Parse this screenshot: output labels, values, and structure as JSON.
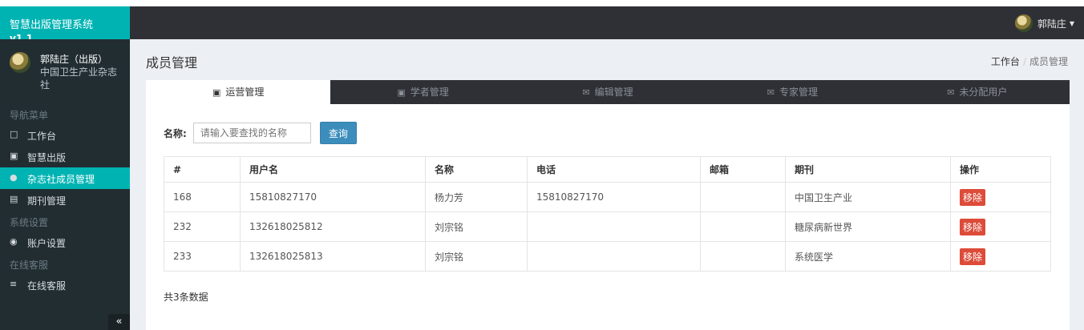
{
  "brand": {
    "title": "智慧出版管理系统",
    "version": "v1.1"
  },
  "user": {
    "name": "郭陆庄（出版）",
    "org": "中国卫生产业杂志社",
    "top_name": "郭陆庄"
  },
  "sidebar": {
    "nav_header": "导航菜单",
    "items": [
      {
        "label": "工作台",
        "icon": "laptop-icon"
      },
      {
        "label": "智慧出版",
        "icon": "book-icon"
      },
      {
        "label": "杂志社成员管理",
        "icon": "user-icon",
        "active": true
      },
      {
        "label": "期刊管理",
        "icon": "newspaper-icon"
      }
    ],
    "system_header": "系统设置",
    "account": {
      "label": "账户设置",
      "icon": "user-circle-icon"
    },
    "service_header": "在线客服",
    "service": {
      "label": "在线客服",
      "icon": "bars-icon"
    },
    "collapse": "«"
  },
  "page": {
    "title": "成员管理"
  },
  "breadcrumb": {
    "home": "工作台",
    "current": "成员管理"
  },
  "tabs": [
    {
      "label": "运营管理",
      "icon": "image-icon",
      "active": true
    },
    {
      "label": "学者管理",
      "icon": "cart-icon"
    },
    {
      "label": "编辑管理",
      "icon": "envelope-icon"
    },
    {
      "label": "专家管理",
      "icon": "envelope-icon"
    },
    {
      "label": "未分配用户",
      "icon": "envelope-icon"
    }
  ],
  "search": {
    "label": "名称:",
    "placeholder": "请输入要查找的名称",
    "button": "查询"
  },
  "table": {
    "headers": [
      "#",
      "用户名",
      "名称",
      "电话",
      "邮箱",
      "期刊",
      "操作"
    ],
    "rows": [
      {
        "id": "168",
        "username": "15810827170",
        "name": "杨力芳",
        "phone": "15810827170",
        "email": "",
        "journal": "中国卫生产业",
        "action": "移除"
      },
      {
        "id": "232",
        "username": "132618025812",
        "name": "刘宗铭",
        "phone": "",
        "email": "",
        "journal": "糖尿病新世界",
        "action": "移除"
      },
      {
        "id": "233",
        "username": "132618025813",
        "name": "刘宗铭",
        "phone": "",
        "email": "",
        "journal": "系统医学",
        "action": "移除"
      }
    ]
  },
  "footer": {
    "total": "共3条数据"
  },
  "colors": {
    "accent": "#00b3b3",
    "sidebar_bg": "#222d32",
    "topbar_bg": "#2e3035",
    "primary_button": "#3c8dbc",
    "danger": "#dd4b39",
    "content_bg": "#ecf0f5"
  }
}
